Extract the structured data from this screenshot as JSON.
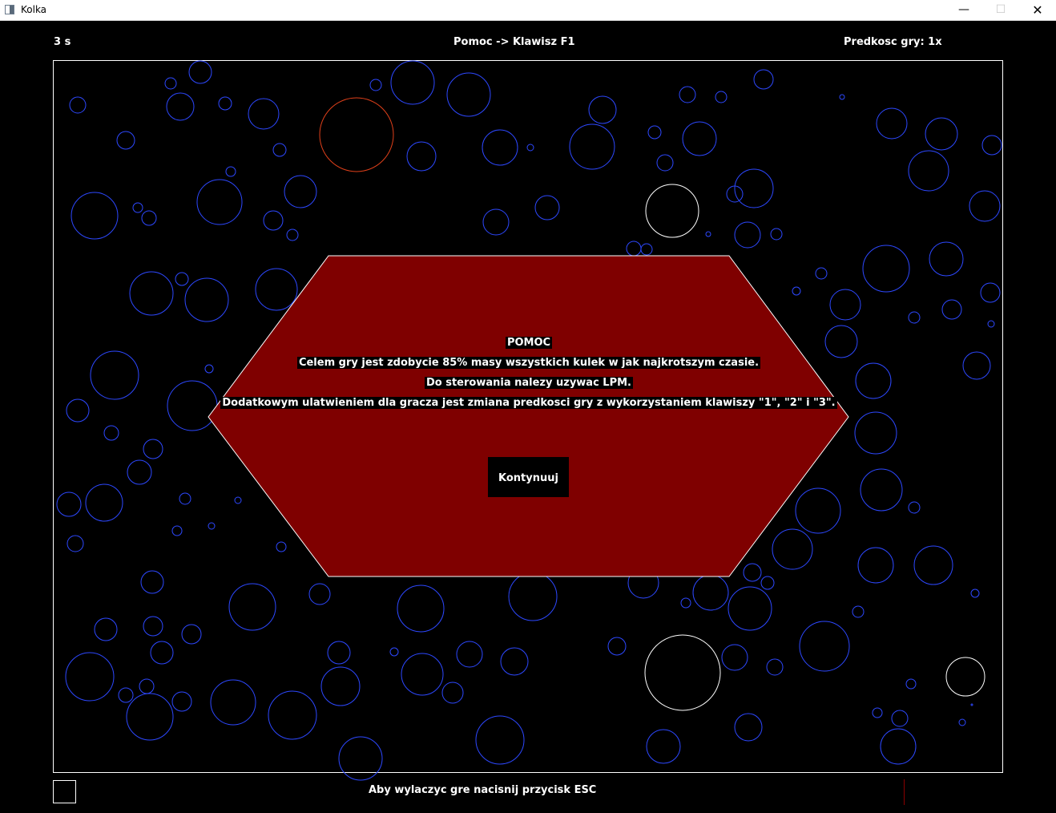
{
  "window": {
    "title": "Kolka",
    "minimize_glyph": "—",
    "maximize_glyph": "☐",
    "close_glyph": "✕"
  },
  "hud": {
    "timer": "3 s",
    "help_hint": "Pomoc -> Klawisz F1",
    "speed": "Predkosc gry: 1x",
    "exit_hint": "Aby wylaczyc gre nacisnij przycisk ESC"
  },
  "help_dialog": {
    "title": "POMOC",
    "line1": "Celem gry jest zdobycie 85% masy wszystkich kulek w jak najkrotszym czasie.",
    "line2": "Do sterowania nalezy uzywac LPM.",
    "line3": "Dodatkowym ulatwieniem dla gracza jest zmiana predkosci gry z wykorzystaniem klawiszy \"1\", \"2\" i \"3\".",
    "button_label": "Kontynuuj"
  },
  "colors": {
    "background": "#000000",
    "enemy_ball": "#2d48ff",
    "player_ball": "#e0401a",
    "neutral_ball": "#ffffff",
    "dialog_fill": "#7f0000",
    "dialog_stroke": "#ffffff"
  }
}
